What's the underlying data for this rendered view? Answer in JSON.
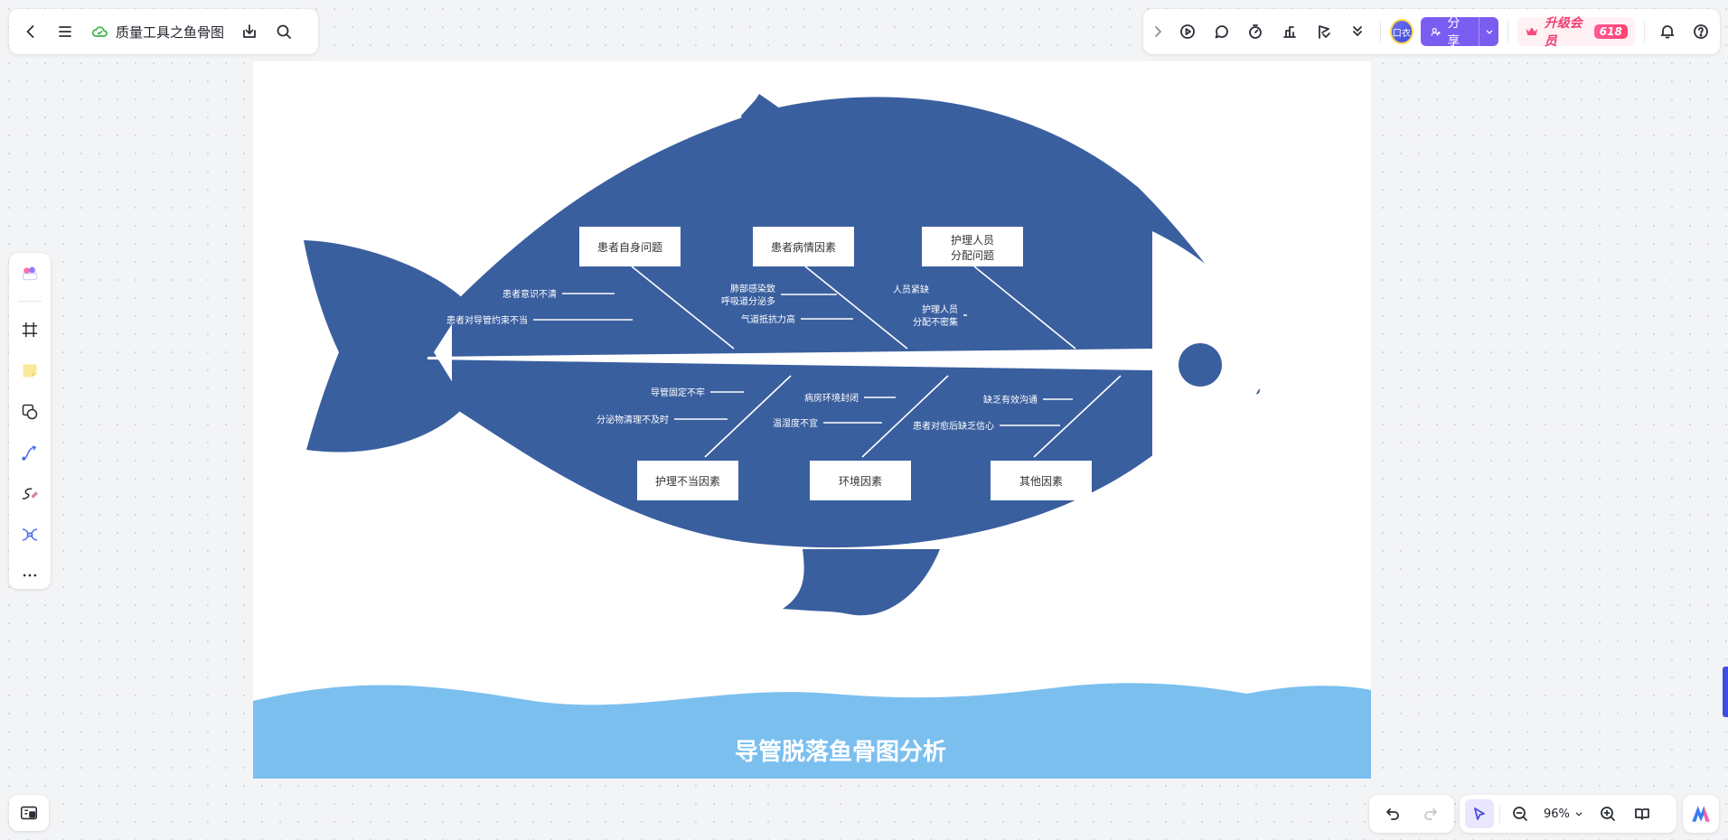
{
  "topbar": {
    "doc_title": "质量工具之鱼骨图"
  },
  "toolbar_right": {
    "avatar_text": "口衣",
    "share_label": "分享",
    "upgrade_label": "升级会员",
    "upgrade_badge": "618"
  },
  "zoom": {
    "value": "96%"
  },
  "fishbone": {
    "title": "导管脱落鱼骨图分析",
    "colors": {
      "fish": "#3a5f9f",
      "water": "#7bbfef",
      "box": "#ffffff"
    },
    "top_categories": [
      {
        "name": "患者自身问题",
        "causes": [
          "患者意识不清",
          "患者对导管约束不当"
        ]
      },
      {
        "name": "患者病情因素",
        "causes": [
          "肺部感染致呼吸道分泌多",
          "气道抵抗力高"
        ],
        "cause_lines": [
          [
            "肺部感染致",
            "呼吸道分泌多"
          ],
          [
            "气道抵抗力高"
          ]
        ]
      },
      {
        "name": "护理人员分配问题",
        "name_lines": [
          "护理人员",
          "分配问题"
        ],
        "causes": [
          "人员紧缺",
          "护理人员分配不密集"
        ],
        "cause_lines": [
          [
            "人员紧缺"
          ],
          [
            "护理人员",
            "分配不密集"
          ]
        ]
      }
    ],
    "bottom_categories": [
      {
        "name": "护理不当因素",
        "causes": [
          "导管固定不牢",
          "分泌物清理不及时"
        ]
      },
      {
        "name": "环境因素",
        "causes": [
          "病房环境封闭",
          "温湿度不宜"
        ]
      },
      {
        "name": "其他因素",
        "causes": [
          "缺乏有效沟通",
          "患者对愈后缺乏信心"
        ]
      }
    ]
  }
}
